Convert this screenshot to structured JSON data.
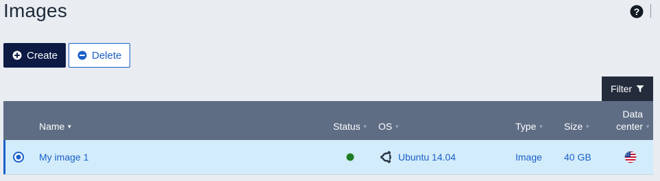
{
  "header": {
    "title": "Images"
  },
  "toolbar": {
    "create_label": "Create",
    "delete_label": "Delete",
    "filter_label": "Filter"
  },
  "table": {
    "columns": {
      "name": "Name",
      "status": "Status",
      "os": "OS",
      "type": "Type",
      "size": "Size",
      "datacenter_line1": "Data",
      "datacenter_line2": "center"
    },
    "rows": [
      {
        "selected": true,
        "name": "My image 1",
        "status": "active",
        "status_color": "#1e7d24",
        "os": "Ubuntu 14.04",
        "os_icon": "ubuntu-icon",
        "type": "Image",
        "size": "40 GB",
        "datacenter_icon": "us-flag-icon"
      }
    ]
  },
  "colors": {
    "primary_dark": "#0c1a44",
    "link_blue": "#1a5fc8",
    "header_bg": "#5e6c84",
    "row_selected_bg": "#d3ecfb",
    "page_bg": "#e9ecf1"
  }
}
